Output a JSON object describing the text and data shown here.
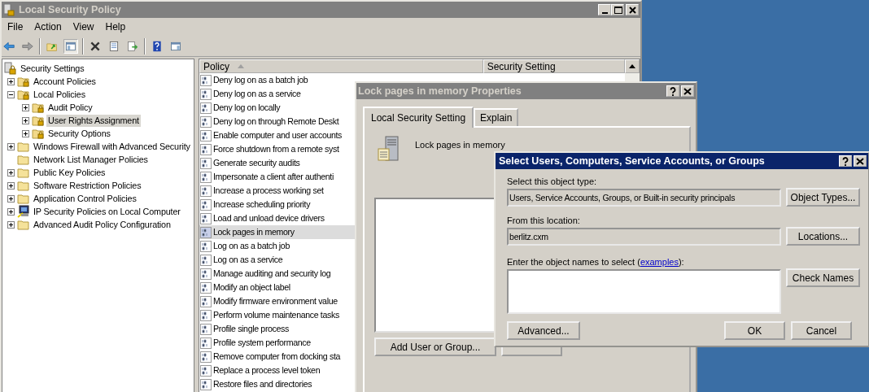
{
  "window": {
    "title": "Local Security Policy"
  },
  "menu": [
    "File",
    "Action",
    "View",
    "Help"
  ],
  "tree": [
    {
      "label": "Security Settings",
      "kind": "root",
      "selected": false,
      "children": [
        {
          "label": "Account Policies",
          "kind": "locked-folder",
          "expanded": false,
          "selected": false
        },
        {
          "label": "Local Policies",
          "kind": "locked-folder",
          "expanded": true,
          "selected": false,
          "children": [
            {
              "label": "Audit Policy",
              "kind": "locked-folder",
              "expanded": false,
              "selected": false
            },
            {
              "label": "User Rights Assignment",
              "kind": "locked-folder",
              "expanded": false,
              "selected": true
            },
            {
              "label": "Security Options",
              "kind": "locked-folder",
              "expanded": false,
              "selected": false
            }
          ]
        },
        {
          "label": "Windows Firewall with Advanced Security",
          "kind": "folder",
          "expanded": false,
          "selected": false
        },
        {
          "label": "Network List Manager Policies",
          "kind": "folder",
          "selected": false
        },
        {
          "label": "Public Key Policies",
          "kind": "folder",
          "expanded": false,
          "selected": false
        },
        {
          "label": "Software Restriction Policies",
          "kind": "folder",
          "expanded": false,
          "selected": false
        },
        {
          "label": "Application Control Policies",
          "kind": "folder",
          "expanded": false,
          "selected": false
        },
        {
          "label": "IP Security Policies on Local Computer",
          "kind": "ip-security",
          "expanded": false,
          "selected": false
        },
        {
          "label": "Advanced Audit Policy Configuration",
          "kind": "folder",
          "expanded": false,
          "selected": false
        }
      ]
    }
  ],
  "list": {
    "columns": [
      {
        "label": "Policy",
        "sorted": true
      },
      {
        "label": "Security Setting",
        "sorted": false
      }
    ],
    "rows": [
      {
        "policy": "Deny log on as a batch job",
        "selected": false
      },
      {
        "policy": "Deny log on as a service",
        "selected": false
      },
      {
        "policy": "Deny log on locally",
        "selected": false
      },
      {
        "policy": "Deny log on through Remote Deskt",
        "selected": false
      },
      {
        "policy": "Enable computer and user accounts",
        "selected": false
      },
      {
        "policy": "Force shutdown from a remote syst",
        "selected": false
      },
      {
        "policy": "Generate security audits",
        "selected": false
      },
      {
        "policy": "Impersonate a client after authenti",
        "selected": false
      },
      {
        "policy": "Increase a process working set",
        "selected": false
      },
      {
        "policy": "Increase scheduling priority",
        "selected": false
      },
      {
        "policy": "Load and unload device drivers",
        "selected": false
      },
      {
        "policy": "Lock pages in memory",
        "selected": true
      },
      {
        "policy": "Log on as a batch job",
        "selected": false
      },
      {
        "policy": "Log on as a service",
        "selected": false
      },
      {
        "policy": "Manage auditing and security log",
        "selected": false
      },
      {
        "policy": "Modify an object label",
        "selected": false
      },
      {
        "policy": "Modify firmware environment value",
        "selected": false
      },
      {
        "policy": "Perform volume maintenance tasks",
        "selected": false
      },
      {
        "policy": "Profile single process",
        "selected": false
      },
      {
        "policy": "Profile system performance",
        "selected": false
      },
      {
        "policy": "Remove computer from docking sta",
        "selected": false
      },
      {
        "policy": "Replace a process level token",
        "selected": false
      },
      {
        "policy": "Restore files and directories",
        "selected": false
      }
    ]
  },
  "properties_dialog": {
    "title": "Lock pages in memory Properties",
    "tabs": [
      {
        "label": "Local Security Setting",
        "selected": true
      },
      {
        "label": "Explain",
        "selected": false
      }
    ],
    "policy_name": "Lock pages in memory",
    "buttons": [
      "Add User or Group..."
    ]
  },
  "select_dialog": {
    "title": "Select Users, Computers, Service Accounts, or Groups",
    "object_type": {
      "label": "Select this object type:",
      "value": "Users, Service Accounts, Groups, or Built-in security principals",
      "button": "Object Types..."
    },
    "location": {
      "label": "From this location:",
      "value": "berlitz.cxm",
      "button": "Locations..."
    },
    "names": {
      "label_before": "Enter the object names to select (",
      "link": "examples",
      "label_after": "):",
      "button": "Check Names"
    },
    "buttons": [
      "Advanced...",
      "OK",
      "Cancel"
    ]
  }
}
